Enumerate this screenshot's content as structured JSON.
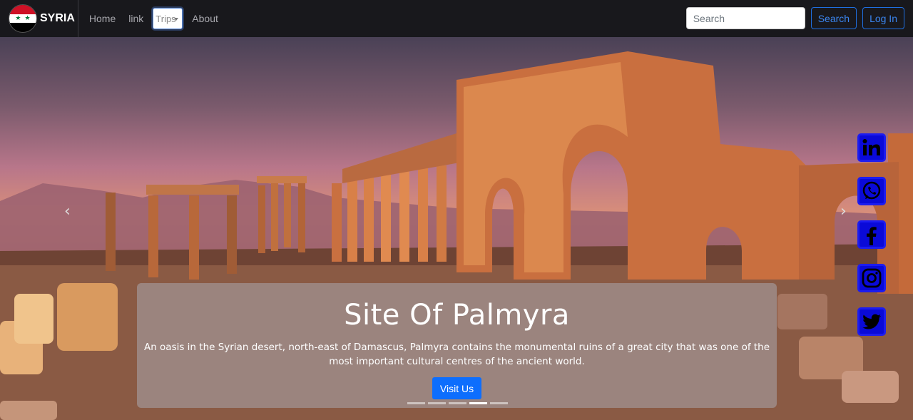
{
  "nav": {
    "brand": "SYRIA",
    "links": [
      "Home",
      "link"
    ],
    "dropdown_label": "Trips",
    "about": "About",
    "search_placeholder": "Search",
    "search_button": "Search",
    "login_button": "Log In"
  },
  "carousel": {
    "title": "Site Of Palmyra",
    "description": "An oasis in the Syrian desert, north-east of Damascus, Palmyra contains the monumental ruins of a great city that was one of the most important cultural centres of the ancient world.",
    "button": "Visit Us",
    "prev_arrow": "‹",
    "next_arrow": "›",
    "slide_count": 5,
    "active_index": 3
  },
  "social": [
    {
      "name": "linkedin-icon",
      "glyph": "in"
    },
    {
      "name": "whatsapp-icon",
      "glyph": "✆"
    },
    {
      "name": "facebook-icon",
      "glyph": "f"
    },
    {
      "name": "instagram-icon",
      "glyph": "◎"
    },
    {
      "name": "twitter-icon",
      "glyph": "🐦"
    }
  ],
  "colors": {
    "accent": "#0d6efd",
    "social_blue": "#0a0ad8",
    "navbar": "#18181c"
  }
}
